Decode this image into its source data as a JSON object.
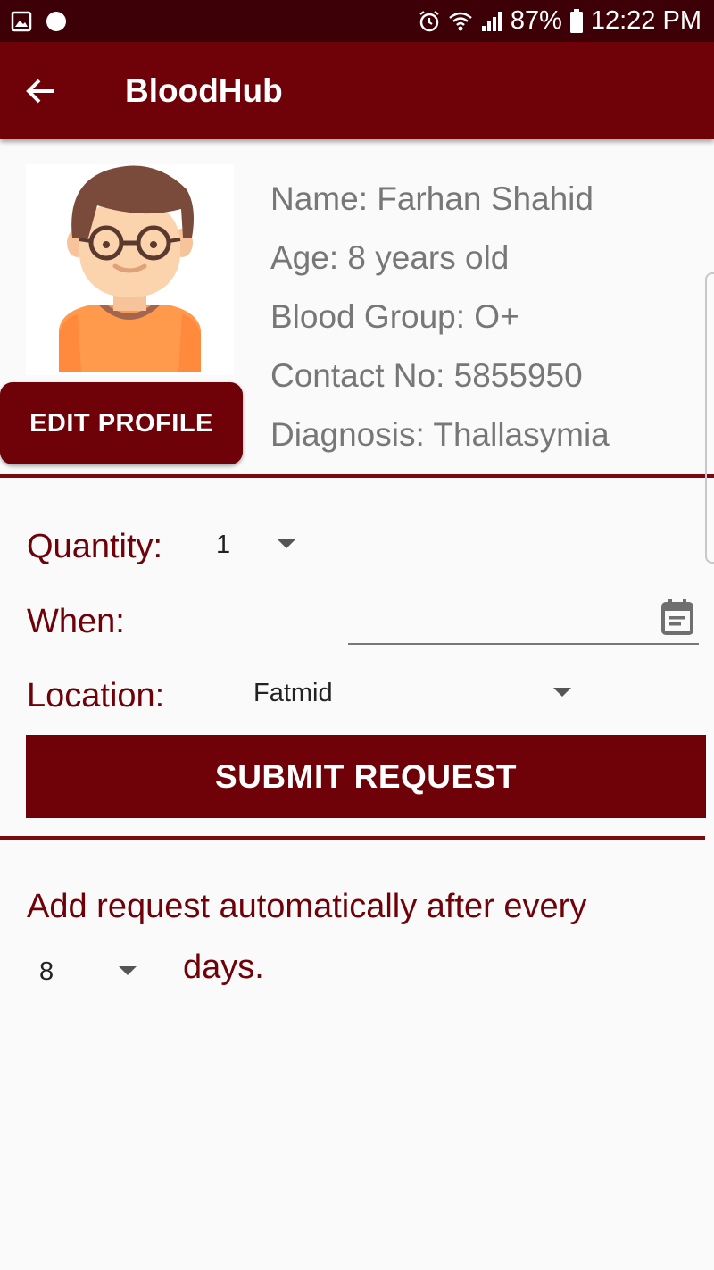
{
  "status_bar": {
    "battery": "87%",
    "time": "12:22 PM",
    "icons": [
      "image-notification-icon",
      "circle-notification-icon",
      "alarm-icon",
      "wifi-icon",
      "signal-icon",
      "battery-icon"
    ]
  },
  "app_bar": {
    "title": "BloodHub",
    "back_icon": "arrow-left-icon"
  },
  "profile": {
    "avatar_icon": "boy-avatar-icon",
    "edit_label": "EDIT PROFILE",
    "name": "Name: Farhan Shahid",
    "age": "Age: 8 years old",
    "blood_group": "Blood Group: O+",
    "contact": "Contact No: 5855950",
    "diagnosis": "Diagnosis: Thallasymia"
  },
  "form": {
    "quantity_label": "Quantity:",
    "quantity_value": "1",
    "when_label": "When:",
    "when_value": "",
    "location_label": "Location:",
    "location_value": "Fatmid",
    "submit_label": "SUBMIT REQUEST"
  },
  "auto_request": {
    "text": "Add request automatically after every",
    "interval_value": "8",
    "unit": "days."
  },
  "colors": {
    "primary": "#6e0208",
    "status_bar": "#3d0006",
    "label_text": "#6e0208",
    "info_text": "#777777",
    "background": "#fafafa"
  }
}
